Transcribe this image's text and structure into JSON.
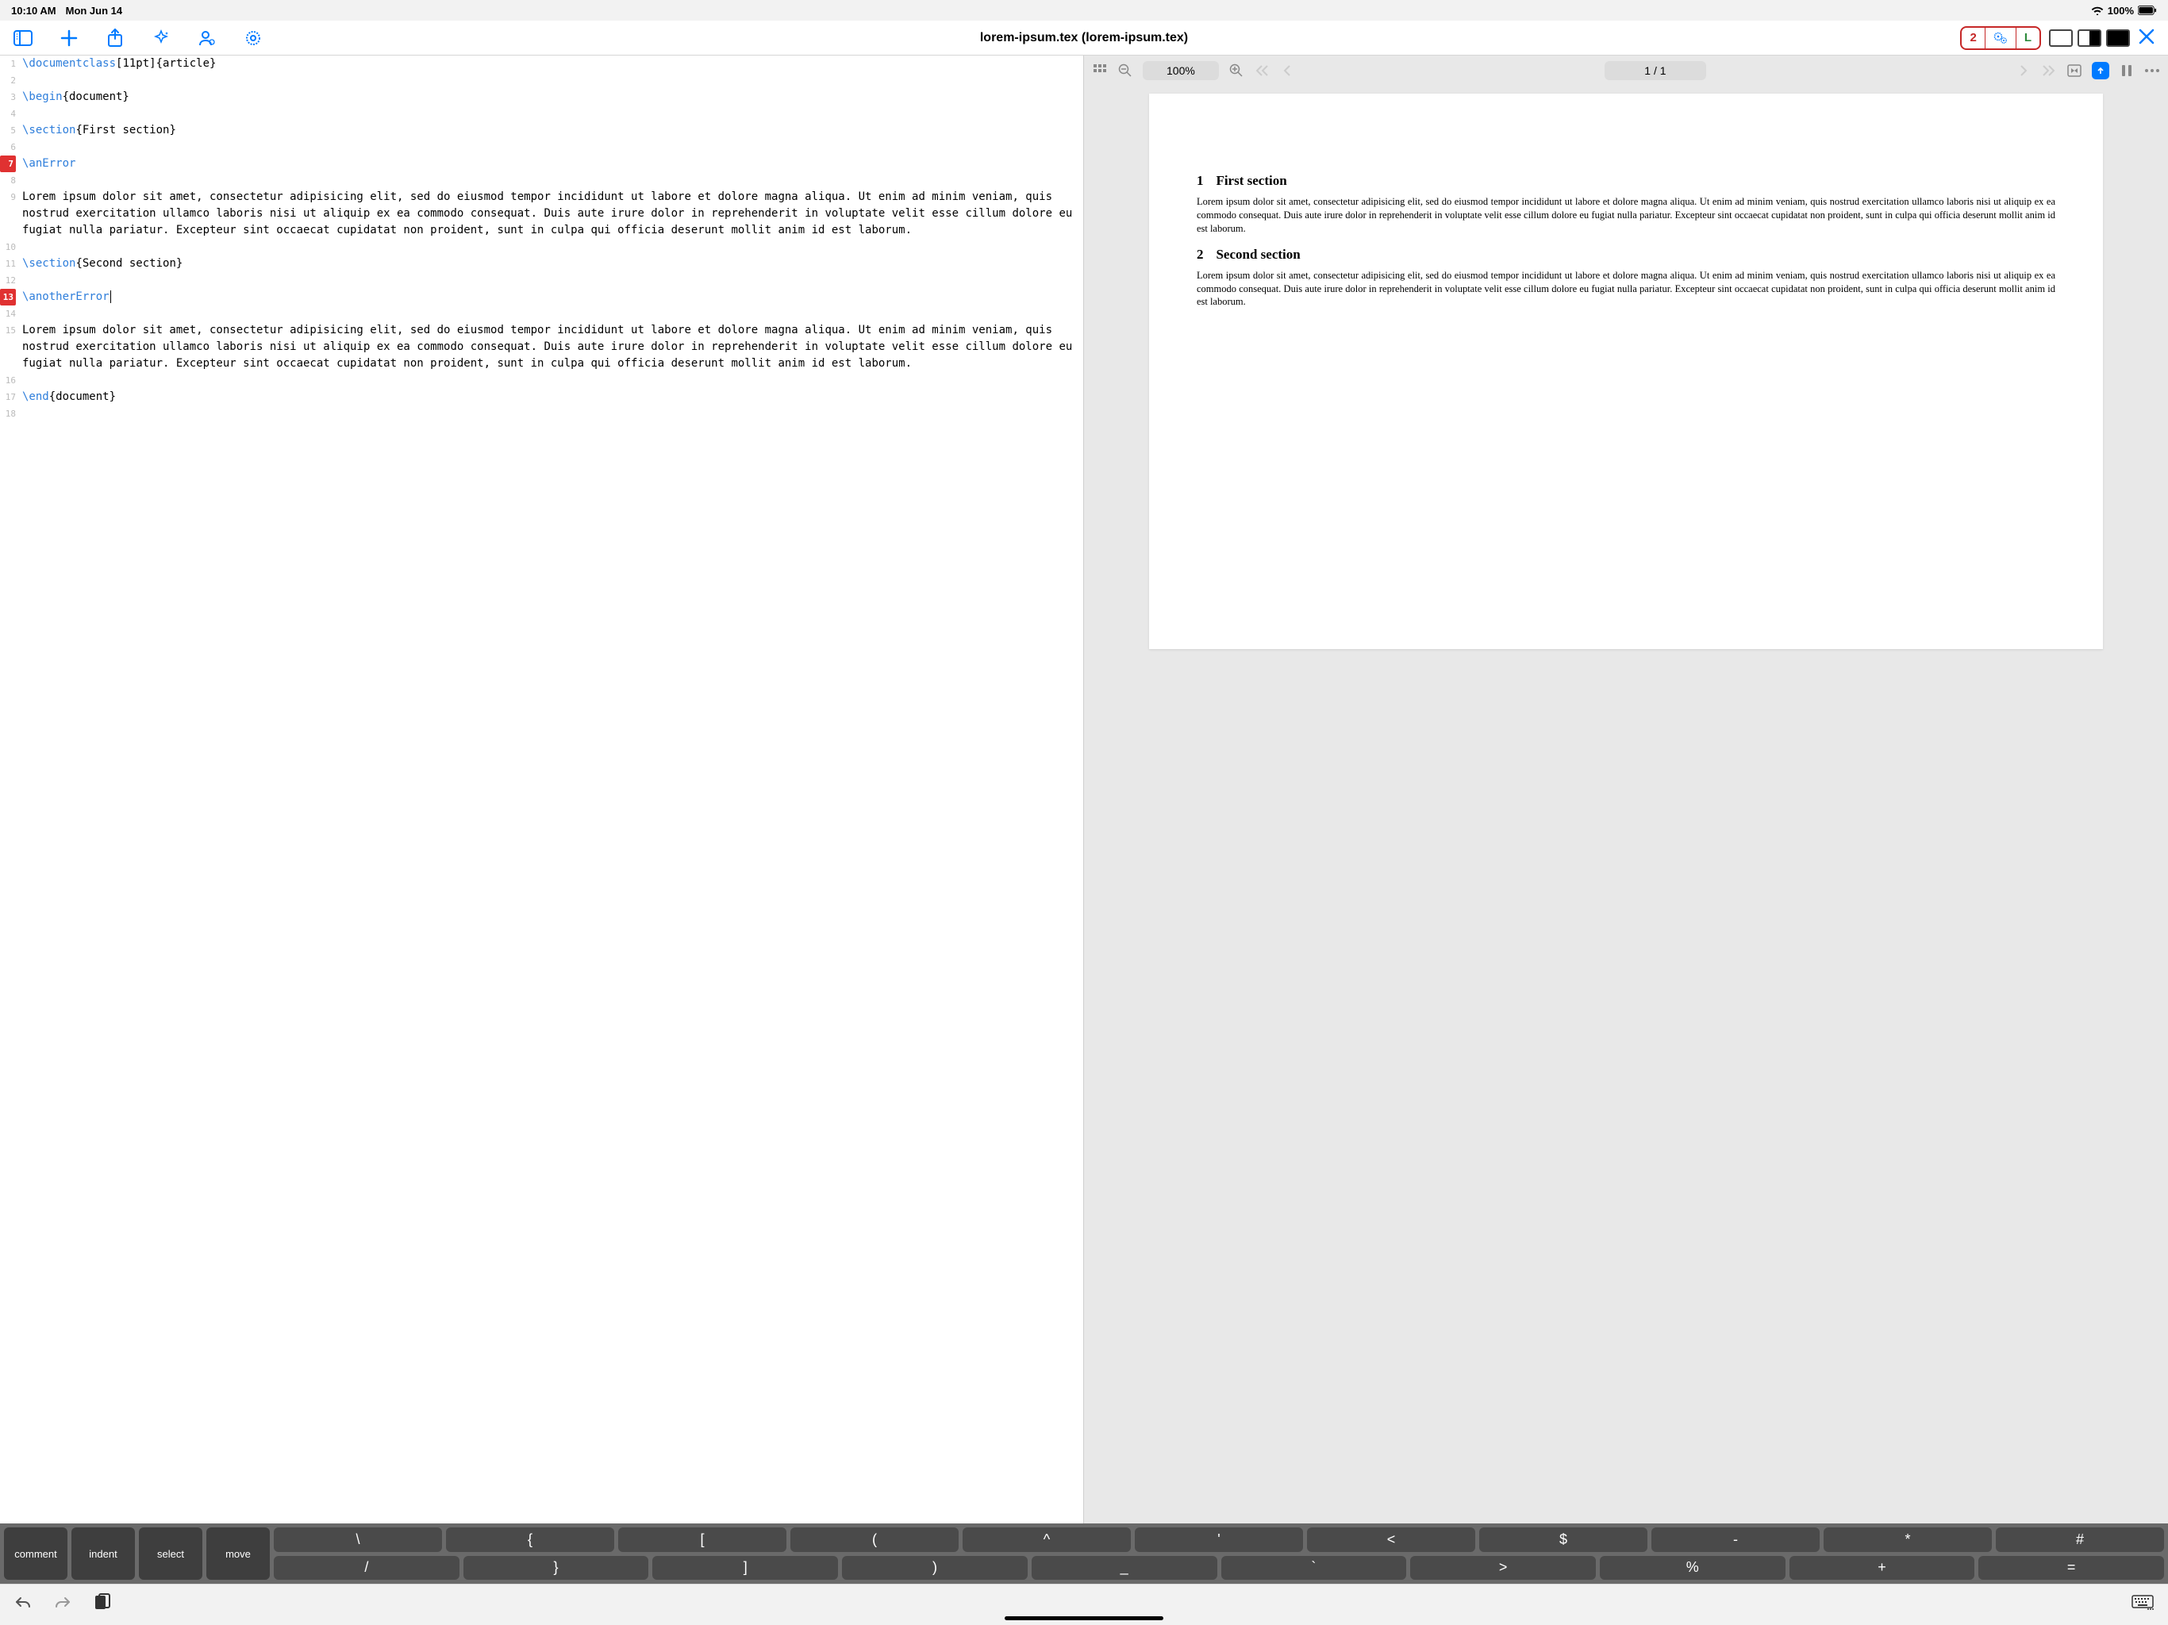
{
  "status": {
    "time": "10:10 AM",
    "date": "Mon Jun 14",
    "battery": "100%"
  },
  "toolbar": {
    "title": "lorem-ipsum.tex (lorem-ipsum.tex)",
    "error_count": "2",
    "typeset_label": "L"
  },
  "editor": {
    "lines": [
      {
        "n": 1,
        "error": false,
        "segs": [
          {
            "t": "\\documentclass",
            "c": "cmd"
          },
          {
            "t": "[11pt]{article}",
            "c": "plain"
          }
        ]
      },
      {
        "n": 2,
        "error": false,
        "segs": []
      },
      {
        "n": 3,
        "error": false,
        "segs": [
          {
            "t": "\\begin",
            "c": "cmd"
          },
          {
            "t": "{document}",
            "c": "plain"
          }
        ]
      },
      {
        "n": 4,
        "error": false,
        "segs": []
      },
      {
        "n": 5,
        "error": false,
        "segs": [
          {
            "t": "\\section",
            "c": "cmd"
          },
          {
            "t": "{First section}",
            "c": "plain"
          }
        ]
      },
      {
        "n": 6,
        "error": false,
        "segs": []
      },
      {
        "n": 7,
        "error": true,
        "segs": [
          {
            "t": "\\anError",
            "c": "cmd"
          }
        ]
      },
      {
        "n": 8,
        "error": false,
        "segs": []
      },
      {
        "n": 9,
        "error": false,
        "segs": [
          {
            "t": "Lorem ipsum dolor sit amet, consectetur adipisicing elit, sed do eiusmod tempor incididunt ut labore et dolore magna aliqua. Ut enim ad minim veniam, quis nostrud exercitation ullamco laboris nisi ut aliquip ex ea commodo consequat. Duis aute irure dolor in reprehenderit in voluptate velit esse cillum dolore eu fugiat nulla pariatur. Excepteur sint occaecat cupidatat non proident, sunt in culpa qui officia deserunt mollit anim id est laborum.",
            "c": "plain"
          }
        ]
      },
      {
        "n": 10,
        "error": false,
        "segs": []
      },
      {
        "n": 11,
        "error": false,
        "segs": [
          {
            "t": "\\section",
            "c": "cmd"
          },
          {
            "t": "{Second section}",
            "c": "plain"
          }
        ]
      },
      {
        "n": 12,
        "error": false,
        "segs": []
      },
      {
        "n": 13,
        "error": true,
        "segs": [
          {
            "t": "\\anotherError",
            "c": "cmd"
          }
        ],
        "cursor": true
      },
      {
        "n": 14,
        "error": false,
        "segs": []
      },
      {
        "n": 15,
        "error": false,
        "segs": [
          {
            "t": "Lorem ipsum dolor sit amet, consectetur adipisicing elit, sed do eiusmod tempor incididunt ut labore et dolore magna aliqua. Ut enim ad minim veniam, quis nostrud exercitation ullamco laboris nisi ut aliquip ex ea commodo consequat. Duis aute irure dolor in reprehenderit in voluptate velit esse cillum dolore eu fugiat nulla pariatur. Excepteur sint occaecat cupidatat non proident, sunt in culpa qui officia deserunt mollit anim id est laborum.",
            "c": "plain"
          }
        ]
      },
      {
        "n": 16,
        "error": false,
        "segs": []
      },
      {
        "n": 17,
        "error": false,
        "segs": [
          {
            "t": "\\end",
            "c": "cmd"
          },
          {
            "t": "{document}",
            "c": "plain"
          }
        ]
      },
      {
        "n": 18,
        "error": false,
        "segs": []
      }
    ]
  },
  "preview": {
    "zoom": "100%",
    "page": "1 / 1",
    "sections": [
      {
        "num": "1",
        "title": "First section",
        "body": "Lorem ipsum dolor sit amet, consectetur adipisicing elit, sed do eiusmod tempor incididunt ut labore et dolore magna aliqua. Ut enim ad minim veniam, quis nostrud exercitation ullamco laboris nisi ut aliquip ex ea commodo consequat. Duis aute irure dolor in reprehenderit in voluptate velit esse cillum dolore eu fugiat nulla pariatur. Excepteur sint occaecat cupidatat non proident, sunt in culpa qui officia deserunt mollit anim id est laborum."
      },
      {
        "num": "2",
        "title": "Second section",
        "body": "Lorem ipsum dolor sit amet, consectetur adipisicing elit, sed do eiusmod tempor incididunt ut labore et dolore magna aliqua. Ut enim ad minim veniam, quis nostrud exercitation ullamco laboris nisi ut aliquip ex ea commodo consequat. Duis aute irure dolor in reprehenderit in voluptate velit esse cillum dolore eu fugiat nulla pariatur. Excepteur sint occaecat cupidatat non proident, sunt in culpa qui officia deserunt mollit anim id est laborum."
      }
    ]
  },
  "keyboard": {
    "actions": [
      "comment",
      "indent",
      "select",
      "move"
    ],
    "row1": [
      "\\",
      "{",
      "[",
      "(",
      "^",
      "'",
      "<",
      "$",
      "-",
      "*",
      "#"
    ],
    "row2": [
      "/",
      "}",
      "]",
      ")",
      "_",
      "`",
      ">",
      "%",
      "+",
      "="
    ]
  }
}
